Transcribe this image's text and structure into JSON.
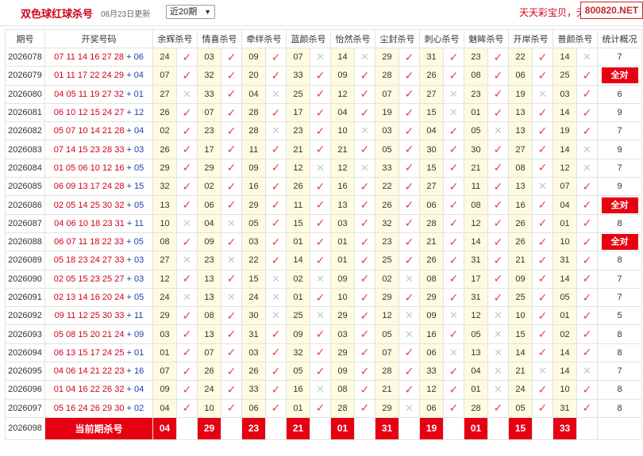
{
  "header": {
    "title": "双色球红球杀号",
    "date": "08月23日更新",
    "select_value": "近20期",
    "marquee": "天天彩宝贝，无",
    "logo": "800820.NET"
  },
  "columns": [
    "期号",
    "开奖号码",
    "余辉杀号",
    "情喜杀号",
    "牵绊杀号",
    "蓝颜杀号",
    "怡然杀号",
    "尘封杀号",
    "刺心杀号",
    "魅眸杀号",
    "开岸杀号",
    "普颜杀号",
    "统计概况"
  ],
  "rows": [
    {
      "issue": "2026078",
      "red": "07 11 14 16 27 28",
      "blue": "06",
      "kills": [
        {
          "v": "24",
          "ok": true
        },
        {
          "v": "03",
          "ok": true
        },
        {
          "v": "09",
          "ok": true
        },
        {
          "v": "07",
          "ok": false
        },
        {
          "v": "14",
          "ok": false
        },
        {
          "v": "29",
          "ok": true
        },
        {
          "v": "31",
          "ok": true
        },
        {
          "v": "23",
          "ok": true
        },
        {
          "v": "22",
          "ok": true
        },
        {
          "v": "14",
          "ok": false
        }
      ],
      "stat": "7"
    },
    {
      "issue": "2026079",
      "red": "01 11 17 22 24 29",
      "blue": "04",
      "kills": [
        {
          "v": "07",
          "ok": true
        },
        {
          "v": "32",
          "ok": true
        },
        {
          "v": "20",
          "ok": true
        },
        {
          "v": "33",
          "ok": true
        },
        {
          "v": "09",
          "ok": true
        },
        {
          "v": "28",
          "ok": true
        },
        {
          "v": "26",
          "ok": true
        },
        {
          "v": "08",
          "ok": true
        },
        {
          "v": "06",
          "ok": true
        },
        {
          "v": "25",
          "ok": true
        }
      ],
      "stat": "全对"
    },
    {
      "issue": "2026080",
      "red": "04 05 11 19 27 32",
      "blue": "01",
      "kills": [
        {
          "v": "27",
          "ok": false
        },
        {
          "v": "33",
          "ok": true
        },
        {
          "v": "04",
          "ok": false
        },
        {
          "v": "25",
          "ok": true
        },
        {
          "v": "12",
          "ok": true
        },
        {
          "v": "07",
          "ok": true
        },
        {
          "v": "27",
          "ok": false
        },
        {
          "v": "23",
          "ok": true
        },
        {
          "v": "19",
          "ok": false
        },
        {
          "v": "03",
          "ok": true
        }
      ],
      "stat": "6"
    },
    {
      "issue": "2026081",
      "red": "06 10 12 15 24 27",
      "blue": "12",
      "kills": [
        {
          "v": "26",
          "ok": true
        },
        {
          "v": "07",
          "ok": true
        },
        {
          "v": "28",
          "ok": true
        },
        {
          "v": "17",
          "ok": true
        },
        {
          "v": "04",
          "ok": true
        },
        {
          "v": "19",
          "ok": true
        },
        {
          "v": "15",
          "ok": false
        },
        {
          "v": "01",
          "ok": true
        },
        {
          "v": "13",
          "ok": true
        },
        {
          "v": "14",
          "ok": true
        }
      ],
      "stat": "9"
    },
    {
      "issue": "2026082",
      "red": "05 07 10 14 21 28",
      "blue": "04",
      "kills": [
        {
          "v": "02",
          "ok": true
        },
        {
          "v": "23",
          "ok": true
        },
        {
          "v": "28",
          "ok": false
        },
        {
          "v": "23",
          "ok": true
        },
        {
          "v": "10",
          "ok": false
        },
        {
          "v": "03",
          "ok": true
        },
        {
          "v": "04",
          "ok": true
        },
        {
          "v": "05",
          "ok": false
        },
        {
          "v": "13",
          "ok": true
        },
        {
          "v": "19",
          "ok": true
        }
      ],
      "stat": "7"
    },
    {
      "issue": "2026083",
      "red": "07 14 15 23 28 33",
      "blue": "03",
      "kills": [
        {
          "v": "26",
          "ok": true
        },
        {
          "v": "17",
          "ok": true
        },
        {
          "v": "11",
          "ok": true
        },
        {
          "v": "21",
          "ok": true
        },
        {
          "v": "21",
          "ok": true
        },
        {
          "v": "05",
          "ok": true
        },
        {
          "v": "30",
          "ok": true
        },
        {
          "v": "30",
          "ok": true
        },
        {
          "v": "27",
          "ok": true
        },
        {
          "v": "14",
          "ok": false
        }
      ],
      "stat": "9"
    },
    {
      "issue": "2026084",
      "red": "01 05 06 10 12 16",
      "blue": "05",
      "kills": [
        {
          "v": "29",
          "ok": true
        },
        {
          "v": "29",
          "ok": true
        },
        {
          "v": "09",
          "ok": true
        },
        {
          "v": "12",
          "ok": false
        },
        {
          "v": "12",
          "ok": false
        },
        {
          "v": "33",
          "ok": true
        },
        {
          "v": "15",
          "ok": true
        },
        {
          "v": "21",
          "ok": true
        },
        {
          "v": "08",
          "ok": true
        },
        {
          "v": "12",
          "ok": false
        }
      ],
      "stat": "7"
    },
    {
      "issue": "2026085",
      "red": "06 09 13 17 24 28",
      "blue": "15",
      "kills": [
        {
          "v": "32",
          "ok": true
        },
        {
          "v": "02",
          "ok": true
        },
        {
          "v": "16",
          "ok": true
        },
        {
          "v": "26",
          "ok": true
        },
        {
          "v": "16",
          "ok": true
        },
        {
          "v": "22",
          "ok": true
        },
        {
          "v": "27",
          "ok": true
        },
        {
          "v": "11",
          "ok": true
        },
        {
          "v": "13",
          "ok": false
        },
        {
          "v": "07",
          "ok": true
        }
      ],
      "stat": "9"
    },
    {
      "issue": "2026086",
      "red": "02 05 14 25 30 32",
      "blue": "05",
      "kills": [
        {
          "v": "13",
          "ok": true
        },
        {
          "v": "06",
          "ok": true
        },
        {
          "v": "29",
          "ok": true
        },
        {
          "v": "11",
          "ok": true
        },
        {
          "v": "13",
          "ok": true
        },
        {
          "v": "26",
          "ok": true
        },
        {
          "v": "06",
          "ok": true
        },
        {
          "v": "08",
          "ok": true
        },
        {
          "v": "16",
          "ok": true
        },
        {
          "v": "04",
          "ok": true
        }
      ],
      "stat": "全对"
    },
    {
      "issue": "2026087",
      "red": "04 06 10 18 23 31",
      "blue": "11",
      "kills": [
        {
          "v": "10",
          "ok": false
        },
        {
          "v": "04",
          "ok": false
        },
        {
          "v": "05",
          "ok": true
        },
        {
          "v": "15",
          "ok": true
        },
        {
          "v": "03",
          "ok": true
        },
        {
          "v": "32",
          "ok": true
        },
        {
          "v": "28",
          "ok": true
        },
        {
          "v": "12",
          "ok": true
        },
        {
          "v": "26",
          "ok": true
        },
        {
          "v": "01",
          "ok": true
        }
      ],
      "stat": "8"
    },
    {
      "issue": "2026088",
      "red": "06 07 11 18 22 33",
      "blue": "05",
      "kills": [
        {
          "v": "08",
          "ok": true
        },
        {
          "v": "09",
          "ok": true
        },
        {
          "v": "03",
          "ok": true
        },
        {
          "v": "01",
          "ok": true
        },
        {
          "v": "01",
          "ok": true
        },
        {
          "v": "23",
          "ok": true
        },
        {
          "v": "21",
          "ok": true
        },
        {
          "v": "14",
          "ok": true
        },
        {
          "v": "26",
          "ok": true
        },
        {
          "v": "10",
          "ok": true
        }
      ],
      "stat": "全对"
    },
    {
      "issue": "2026089",
      "red": "05 18 23 24 27 33",
      "blue": "03",
      "kills": [
        {
          "v": "27",
          "ok": false
        },
        {
          "v": "23",
          "ok": false
        },
        {
          "v": "22",
          "ok": true
        },
        {
          "v": "14",
          "ok": true
        },
        {
          "v": "01",
          "ok": true
        },
        {
          "v": "25",
          "ok": true
        },
        {
          "v": "26",
          "ok": true
        },
        {
          "v": "31",
          "ok": true
        },
        {
          "v": "21",
          "ok": true
        },
        {
          "v": "31",
          "ok": true
        }
      ],
      "stat": "8"
    },
    {
      "issue": "2026090",
      "red": "02 05 15 23 25 27",
      "blue": "03",
      "kills": [
        {
          "v": "12",
          "ok": true
        },
        {
          "v": "13",
          "ok": true
        },
        {
          "v": "15",
          "ok": false
        },
        {
          "v": "02",
          "ok": false
        },
        {
          "v": "09",
          "ok": true
        },
        {
          "v": "02",
          "ok": false
        },
        {
          "v": "08",
          "ok": true
        },
        {
          "v": "17",
          "ok": true
        },
        {
          "v": "09",
          "ok": true
        },
        {
          "v": "14",
          "ok": true
        }
      ],
      "stat": "7"
    },
    {
      "issue": "2026091",
      "red": "02 13 14 16 20 24",
      "blue": "05",
      "kills": [
        {
          "v": "24",
          "ok": false
        },
        {
          "v": "13",
          "ok": false
        },
        {
          "v": "24",
          "ok": false
        },
        {
          "v": "01",
          "ok": true
        },
        {
          "v": "10",
          "ok": true
        },
        {
          "v": "29",
          "ok": true
        },
        {
          "v": "29",
          "ok": true
        },
        {
          "v": "31",
          "ok": true
        },
        {
          "v": "25",
          "ok": true
        },
        {
          "v": "05",
          "ok": true
        }
      ],
      "stat": "7"
    },
    {
      "issue": "2026092",
      "red": "09 11 12 25 30 33",
      "blue": "11",
      "kills": [
        {
          "v": "29",
          "ok": true
        },
        {
          "v": "08",
          "ok": true
        },
        {
          "v": "30",
          "ok": false
        },
        {
          "v": "25",
          "ok": false
        },
        {
          "v": "29",
          "ok": true
        },
        {
          "v": "12",
          "ok": false
        },
        {
          "v": "09",
          "ok": false
        },
        {
          "v": "12",
          "ok": false
        },
        {
          "v": "10",
          "ok": true
        },
        {
          "v": "01",
          "ok": true
        }
      ],
      "stat": "5"
    },
    {
      "issue": "2026093",
      "red": "05 08 15 20 21 24",
      "blue": "09",
      "kills": [
        {
          "v": "03",
          "ok": true
        },
        {
          "v": "13",
          "ok": true
        },
        {
          "v": "31",
          "ok": true
        },
        {
          "v": "09",
          "ok": true
        },
        {
          "v": "03",
          "ok": true
        },
        {
          "v": "05",
          "ok": false
        },
        {
          "v": "16",
          "ok": true
        },
        {
          "v": "05",
          "ok": false
        },
        {
          "v": "15",
          "ok": true
        },
        {
          "v": "02",
          "ok": true
        }
      ],
      "stat": "8"
    },
    {
      "issue": "2026094",
      "red": "06 13 15 17 24 25",
      "blue": "01",
      "kills": [
        {
          "v": "01",
          "ok": true
        },
        {
          "v": "07",
          "ok": true
        },
        {
          "v": "03",
          "ok": true
        },
        {
          "v": "32",
          "ok": true
        },
        {
          "v": "29",
          "ok": true
        },
        {
          "v": "07",
          "ok": true
        },
        {
          "v": "06",
          "ok": false
        },
        {
          "v": "13",
          "ok": false
        },
        {
          "v": "14",
          "ok": true
        },
        {
          "v": "14",
          "ok": true
        }
      ],
      "stat": "8"
    },
    {
      "issue": "2026095",
      "red": "04 06 14 21 22 23",
      "blue": "16",
      "kills": [
        {
          "v": "07",
          "ok": true
        },
        {
          "v": "26",
          "ok": true
        },
        {
          "v": "26",
          "ok": true
        },
        {
          "v": "05",
          "ok": true
        },
        {
          "v": "09",
          "ok": true
        },
        {
          "v": "28",
          "ok": true
        },
        {
          "v": "33",
          "ok": true
        },
        {
          "v": "04",
          "ok": false
        },
        {
          "v": "21",
          "ok": false
        },
        {
          "v": "14",
          "ok": false
        }
      ],
      "stat": "7"
    },
    {
      "issue": "2026096",
      "red": "01 04 16 22 26 32",
      "blue": "04",
      "kills": [
        {
          "v": "09",
          "ok": true
        },
        {
          "v": "24",
          "ok": true
        },
        {
          "v": "33",
          "ok": true
        },
        {
          "v": "16",
          "ok": false
        },
        {
          "v": "08",
          "ok": true
        },
        {
          "v": "21",
          "ok": true
        },
        {
          "v": "12",
          "ok": true
        },
        {
          "v": "01",
          "ok": false
        },
        {
          "v": "24",
          "ok": true
        },
        {
          "v": "10",
          "ok": true
        }
      ],
      "stat": "8"
    },
    {
      "issue": "2026097",
      "red": "05 16 24 26 29 30",
      "blue": "02",
      "kills": [
        {
          "v": "04",
          "ok": true
        },
        {
          "v": "10",
          "ok": true
        },
        {
          "v": "06",
          "ok": true
        },
        {
          "v": "01",
          "ok": true
        },
        {
          "v": "28",
          "ok": true
        },
        {
          "v": "29",
          "ok": false
        },
        {
          "v": "06",
          "ok": true
        },
        {
          "v": "28",
          "ok": true
        },
        {
          "v": "05",
          "ok": true
        },
        {
          "v": "31",
          "ok": true
        }
      ],
      "stat": "8"
    }
  ],
  "current": {
    "issue": "2026098",
    "label": "当前期杀号",
    "values": [
      "04",
      "29",
      "23",
      "21",
      "01",
      "31",
      "19",
      "01",
      "15",
      "33"
    ]
  },
  "marks": {
    "ok": "✓",
    "no": "✕"
  }
}
